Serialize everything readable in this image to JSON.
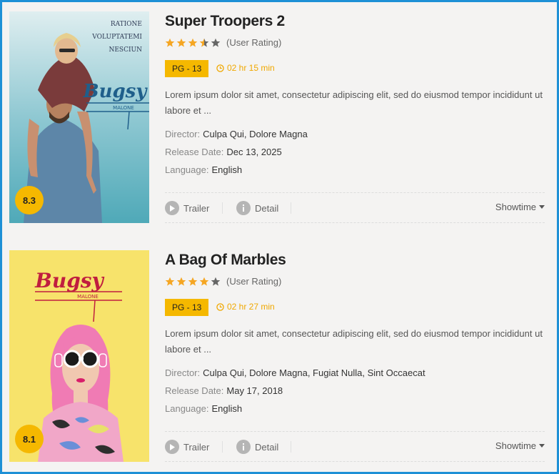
{
  "movies": [
    {
      "title": "Super Troopers 2",
      "stars": 3.5,
      "user_rating_label": "(User Rating)",
      "mpaa": "PG - 13",
      "duration": "02 hr 15 min",
      "description": "Lorem ipsum dolor sit amet, consectetur adipiscing elit, sed do eiusmod tempor incididunt ut labore et ...",
      "director_label": "Director:",
      "director": "Culpa Qui, Dolore Magna",
      "release_label": "Release Date:",
      "release_date": "Dec 13, 2025",
      "language_label": "Language:",
      "language": "English",
      "score": "8.3",
      "poster_text": [
        "RATIONE",
        "VOLUPTATEMI",
        "NESCIUN"
      ],
      "poster_logo": [
        "Bugsy",
        "MALONE"
      ],
      "trailer_label": "Trailer",
      "detail_label": "Detail",
      "showtime_label": "Showtime"
    },
    {
      "title": "A Bag Of Marbles",
      "stars": 4,
      "user_rating_label": "(User Rating)",
      "mpaa": "PG - 13",
      "duration": "02 hr 27 min",
      "description": "Lorem ipsum dolor sit amet, consectetur adipiscing elit, sed do eiusmod tempor incididunt ut labore et ...",
      "director_label": "Director:",
      "director": "Culpa Qui, Dolore Magna, Fugiat Nulla, Sint Occaecat",
      "release_label": "Release Date:",
      "release_date": "May 17, 2018",
      "language_label": "Language:",
      "language": "English",
      "score": "8.1",
      "poster_logo": [
        "Bugsy",
        "MALONE"
      ],
      "trailer_label": "Trailer",
      "detail_label": "Detail",
      "showtime_label": "Showtime"
    }
  ],
  "colors": {
    "accent": "#f5b800",
    "frame_border": "#1e90d6",
    "star_filled": "#f5a623",
    "star_empty": "#666666"
  },
  "icons": {
    "play": "play-icon",
    "info": "info-icon",
    "clock": "clock-icon",
    "caret": "caret-down-icon",
    "star": "star-icon"
  }
}
